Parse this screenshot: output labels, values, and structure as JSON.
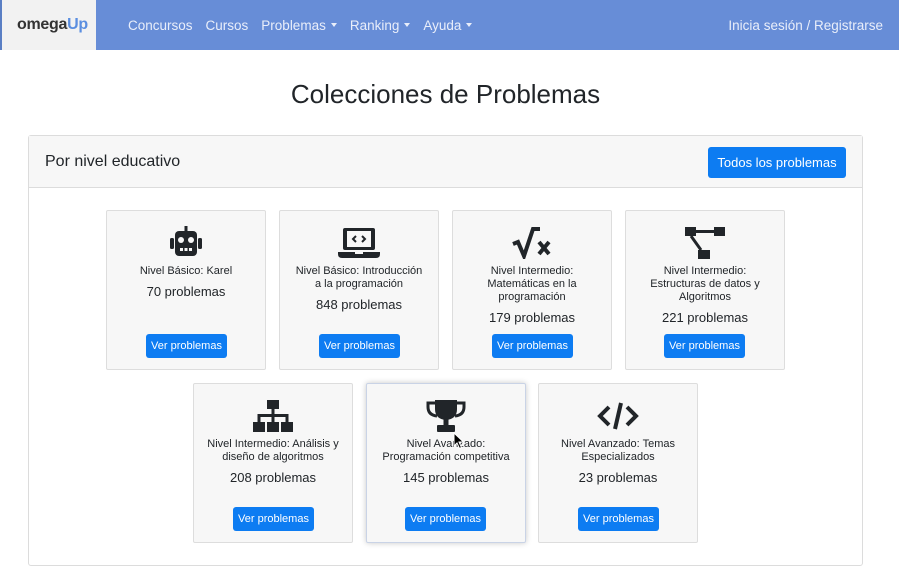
{
  "brand": {
    "part1": "omega",
    "part2": "Up"
  },
  "nav": {
    "items": [
      {
        "label": "Concursos",
        "dropdown": false
      },
      {
        "label": "Cursos",
        "dropdown": false
      },
      {
        "label": "Problemas",
        "dropdown": true
      },
      {
        "label": "Ranking",
        "dropdown": true
      },
      {
        "label": "Ayuda",
        "dropdown": true
      }
    ],
    "login": "Inicia sesión / Registrarse"
  },
  "page": {
    "title": "Colecciones de Problemas"
  },
  "card": {
    "header": "Por nivel educativo",
    "all_button": "Todos los problemas"
  },
  "collections": [
    {
      "name": "Nivel Básico: Karel",
      "count": "70 problemas",
      "button": "Ver problemas",
      "icon": "robot-icon"
    },
    {
      "name": "Nivel Básico: Introducción a la programación",
      "count": "848 problemas",
      "button": "Ver problemas",
      "icon": "laptop-code-icon"
    },
    {
      "name": "Nivel Intermedio: Matemáticas en la programación",
      "count": "179 problemas",
      "button": "Ver problemas",
      "icon": "square-root-icon"
    },
    {
      "name": "Nivel Intermedio: Estructuras de datos y Algoritmos",
      "count": "221 problemas",
      "button": "Ver problemas",
      "icon": "project-diagram-icon"
    },
    {
      "name": "Nivel Intermedio: Análisis y diseño de algoritmos",
      "count": "208 problemas",
      "button": "Ver problemas",
      "icon": "sitemap-icon"
    },
    {
      "name": "Nivel Avanzado: Programación competitiva",
      "count": "145 problemas",
      "button": "Ver problemas",
      "icon": "trophy-icon"
    },
    {
      "name": "Nivel Avanzado: Temas Especializados",
      "count": "23 problemas",
      "button": "Ver problemas",
      "icon": "code-icon"
    }
  ],
  "colors": {
    "navbar": "#678dd7",
    "primary": "#0d7cf2",
    "tile_bg": "#f7f7f7"
  }
}
